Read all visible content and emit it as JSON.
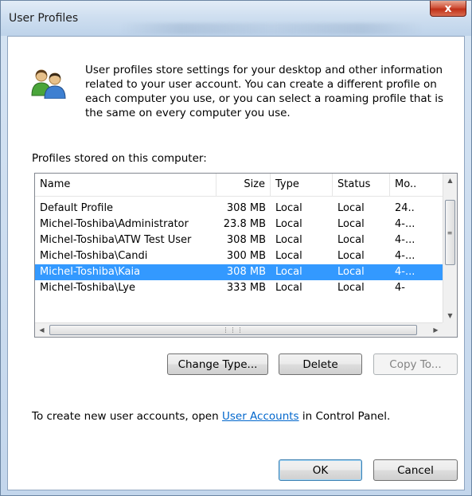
{
  "window": {
    "title": "User Profiles",
    "close_glyph": "x"
  },
  "intro": {
    "text": "User profiles store settings for your desktop and other information related to your user account. You can create a different profile on each computer you use, or you can select a roaming profile that is the same on every computer you use."
  },
  "profiles": {
    "label": "Profiles stored on this computer:",
    "columns": [
      {
        "label": "Name"
      },
      {
        "label": "Size"
      },
      {
        "label": "Type"
      },
      {
        "label": "Status"
      },
      {
        "label": "Mo.."
      }
    ],
    "rows": [
      {
        "name": "Default Profile",
        "size": "308 MB",
        "type": "Local",
        "status": "Local",
        "modified": "24..",
        "selected": false
      },
      {
        "name": "Michel-Toshiba\\Administrator",
        "size": "23.8 MB",
        "type": "Local",
        "status": "Local",
        "modified": "4-...",
        "selected": false
      },
      {
        "name": "Michel-Toshiba\\ATW Test User",
        "size": "308 MB",
        "type": "Local",
        "status": "Local",
        "modified": "4-...",
        "selected": false
      },
      {
        "name": "Michel-Toshiba\\Candi",
        "size": "300 MB",
        "type": "Local",
        "status": "Local",
        "modified": "4-...",
        "selected": false
      },
      {
        "name": "Michel-Toshiba\\Kaia",
        "size": "308 MB",
        "type": "Local",
        "status": "Local",
        "modified": "4-...",
        "selected": true
      },
      {
        "name": "Michel-Toshiba\\Lye",
        "size": "333 MB",
        "type": "Local",
        "status": "Local",
        "modified": "4-",
        "selected": false
      }
    ]
  },
  "actions": {
    "change_type": "Change Type...",
    "delete": "Delete",
    "copy_to": "Copy To..."
  },
  "hint": {
    "prefix": "To create new user accounts, open ",
    "link": "User Accounts",
    "suffix": " in Control Panel."
  },
  "dialog": {
    "ok": "OK",
    "cancel": "Cancel"
  },
  "colors": {
    "selection": "#3399ff",
    "link": "#0066cc",
    "close_button": "#c03018"
  },
  "icons": {
    "dialog": "users-icon",
    "close": "close-icon",
    "scroll_up": "arrow-up-icon",
    "scroll_down": "arrow-down-icon",
    "scroll_left": "arrow-left-icon",
    "scroll_right": "arrow-right-icon"
  }
}
